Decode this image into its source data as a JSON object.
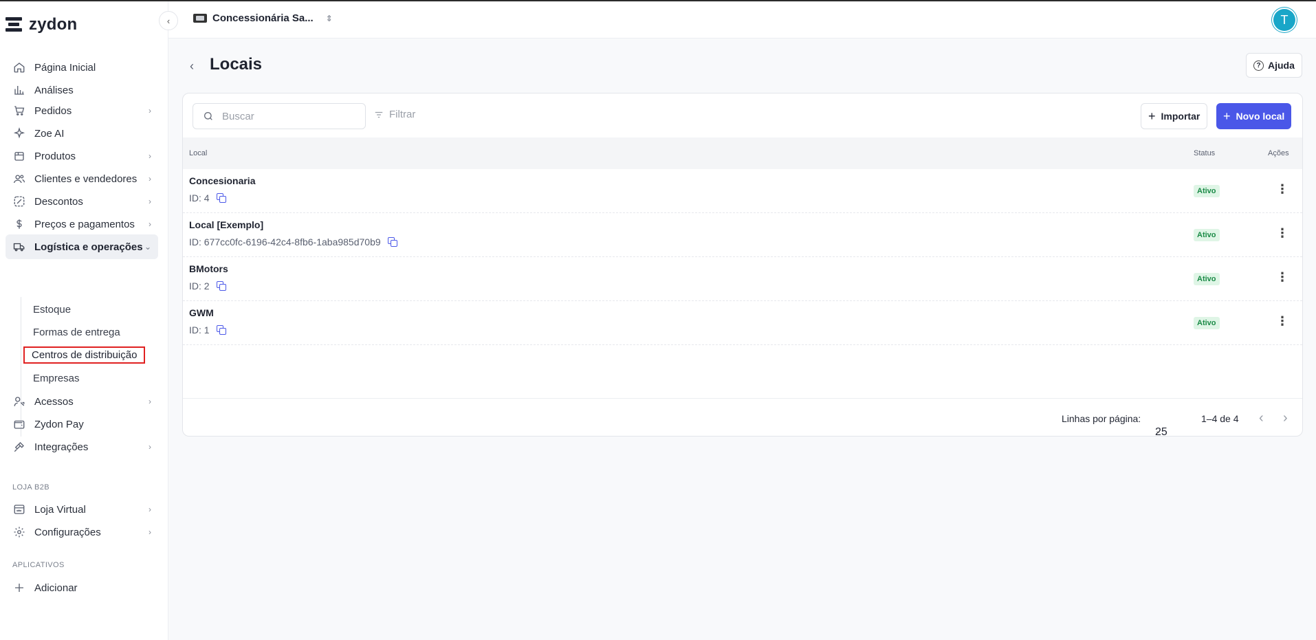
{
  "brand": {
    "name": "zydon"
  },
  "topbar": {
    "org_name": "Concessionária Sa...",
    "avatar_initial": "T"
  },
  "sidebar": {
    "items": [
      {
        "label": "Página Inicial",
        "icon": "home-icon"
      },
      {
        "label": "Análises",
        "icon": "chart-icon"
      },
      {
        "label": "Pedidos",
        "icon": "cart-icon"
      },
      {
        "label": "Zoe AI",
        "icon": "sparkle-icon"
      },
      {
        "label": "Produtos",
        "icon": "box-icon"
      },
      {
        "label": "Clientes e vendedores",
        "icon": "users-icon"
      },
      {
        "label": "Descontos",
        "icon": "discount-icon"
      },
      {
        "label": "Preços e pagamentos",
        "icon": "dollar-icon"
      },
      {
        "label": "Logística e operações",
        "icon": "truck-icon"
      },
      {
        "label": "Acessos",
        "icon": "access-icon"
      },
      {
        "label": "Zydon Pay",
        "icon": "wallet-icon"
      },
      {
        "label": "Integrações",
        "icon": "plug-icon"
      },
      {
        "label": "Loja Virtual",
        "icon": "store-icon"
      },
      {
        "label": "Configurações",
        "icon": "gear-icon"
      },
      {
        "label": "Adicionar",
        "icon": "plus-icon"
      }
    ],
    "sub_items": [
      "Estoque",
      "Formas de entrega",
      "Centros de distribuição",
      "Empresas"
    ],
    "sections": [
      "LOJA B2B",
      "APLICATIVOS"
    ]
  },
  "page": {
    "title": "Locais",
    "help_label": "Ajuda"
  },
  "toolbar": {
    "search_placeholder": "Buscar",
    "filter_label": "Filtrar",
    "import_label": "Importar",
    "new_label": "Novo local"
  },
  "table": {
    "columns": [
      "Local",
      "Status",
      "Ações"
    ],
    "rows": [
      {
        "name": "Concesionaria",
        "id": "ID: 4",
        "status": "Ativo"
      },
      {
        "name": "Local [Exemplo]",
        "id": "ID: 677cc0fc-6196-42c4-8fb6-1aba985d70b9",
        "status": "Ativo"
      },
      {
        "name": "BMotors",
        "id": "ID: 2",
        "status": "Ativo"
      },
      {
        "name": "GWM",
        "id": "ID: 1",
        "status": "Ativo"
      }
    ]
  },
  "pagination": {
    "rows_label": "Linhas por página:",
    "rows_value": "25",
    "range": "1–4 de 4"
  },
  "colors": {
    "primary": "#4a57e8",
    "success_bg": "#dff5e6",
    "success_text": "#1a8a46",
    "avatar": "#19a6c8",
    "highlight": "#e02020"
  }
}
